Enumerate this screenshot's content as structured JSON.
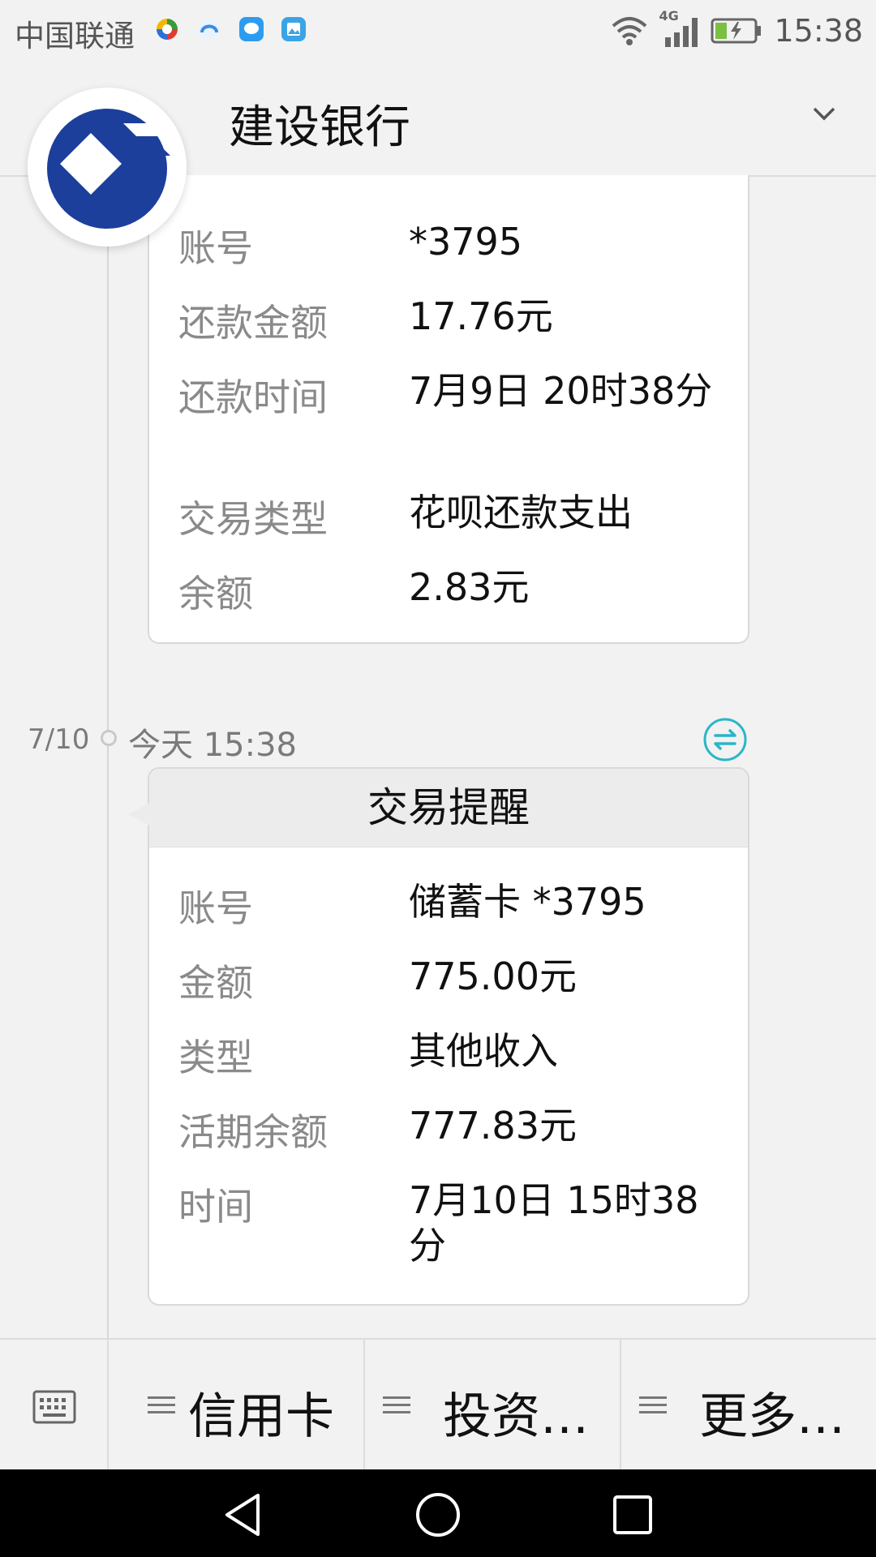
{
  "status_bar": {
    "carrier": "中国联通",
    "network": "4G",
    "time": "15:38",
    "icons": [
      "app-icon-1",
      "app-icon-2",
      "message-app-icon",
      "gallery-app-icon",
      "wifi-icon",
      "signal-icon",
      "battery-charging-icon"
    ]
  },
  "header": {
    "title": "建设银行",
    "logo_icon": "ccb-logo-icon",
    "brand_color": "#1c3f9c"
  },
  "previous_card": {
    "rows": [
      {
        "label": "账号",
        "value": "*3795"
      },
      {
        "label": "还款金额",
        "value": "17.76元"
      },
      {
        "label": "还款时间",
        "value": "7月9日 20时38分"
      },
      {
        "label": "交易类型",
        "value": "花呗还款支出"
      },
      {
        "label": "余额",
        "value": "2.83元"
      }
    ]
  },
  "message": {
    "date": "7/10",
    "time": "今天 15:38",
    "accent_color": "#2ab6c6"
  },
  "transaction_card": {
    "title": "交易提醒",
    "rows": [
      {
        "label": "账号",
        "value": "储蓄卡 *3795"
      },
      {
        "label": "金额",
        "value": "775.00元"
      },
      {
        "label": "类型",
        "value": "其他收入"
      },
      {
        "label": "活期余额",
        "value": "777.83元"
      },
      {
        "label": "时间",
        "value": "7月10日 15时38分"
      }
    ]
  },
  "bottom_menu": {
    "items": [
      {
        "label": "信用卡"
      },
      {
        "label": "投资…"
      },
      {
        "label": "更多…"
      }
    ]
  }
}
